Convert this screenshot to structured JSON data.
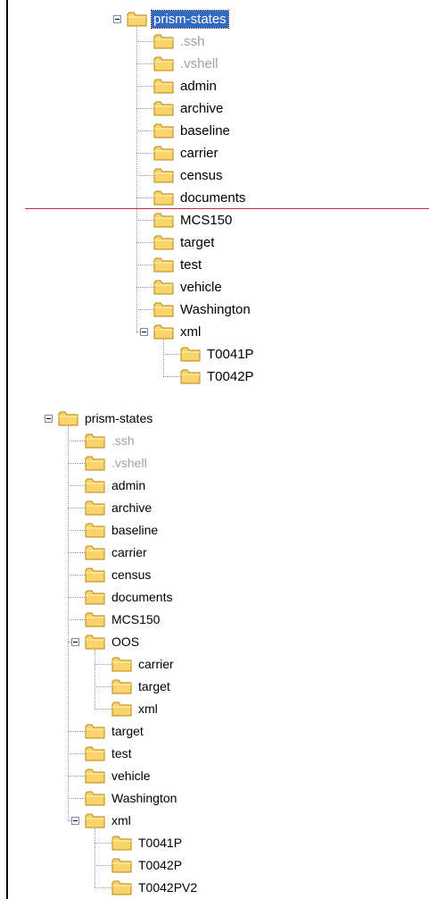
{
  "colors": {
    "selection": "#316ac5",
    "separator": "#d03030",
    "folder_fill": "#f9d46c",
    "folder_stroke": "#b8860b",
    "hidden_text": "#a0a0a0"
  },
  "icons": {
    "folder": "folder-icon",
    "expander": "minus-box-icon"
  },
  "trees": [
    {
      "items": [
        {
          "label": "prism-states",
          "depth": 0,
          "expanded": true,
          "selected": true
        },
        {
          "label": ".ssh",
          "depth": 1,
          "dim": true
        },
        {
          "label": ".vshell",
          "depth": 1,
          "dim": true
        },
        {
          "label": "admin",
          "depth": 1
        },
        {
          "label": "archive",
          "depth": 1
        },
        {
          "label": "baseline",
          "depth": 1
        },
        {
          "label": "carrier",
          "depth": 1
        },
        {
          "label": "census",
          "depth": 1
        },
        {
          "label": "documents",
          "depth": 1
        },
        {
          "label": "MCS150",
          "depth": 1
        },
        {
          "label": "target",
          "depth": 1
        },
        {
          "label": "test",
          "depth": 1
        },
        {
          "label": "vehicle",
          "depth": 1
        },
        {
          "label": "Washington",
          "depth": 1
        },
        {
          "label": "xml",
          "depth": 1,
          "expanded": true
        },
        {
          "label": "T0041P",
          "depth": 2
        },
        {
          "label": "T0042P",
          "depth": 2
        }
      ]
    },
    {
      "items": [
        {
          "label": "prism-states",
          "depth": 0,
          "expanded": true
        },
        {
          "label": ".ssh",
          "depth": 1,
          "dim": true
        },
        {
          "label": ".vshell",
          "depth": 1,
          "dim": true
        },
        {
          "label": "admin",
          "depth": 1
        },
        {
          "label": "archive",
          "depth": 1
        },
        {
          "label": "baseline",
          "depth": 1
        },
        {
          "label": "carrier",
          "depth": 1
        },
        {
          "label": "census",
          "depth": 1
        },
        {
          "label": "documents",
          "depth": 1
        },
        {
          "label": "MCS150",
          "depth": 1
        },
        {
          "label": "OOS",
          "depth": 1,
          "expanded": true
        },
        {
          "label": "carrier",
          "depth": 2
        },
        {
          "label": "target",
          "depth": 2
        },
        {
          "label": "xml",
          "depth": 2
        },
        {
          "label": "target",
          "depth": 1
        },
        {
          "label": "test",
          "depth": 1
        },
        {
          "label": "vehicle",
          "depth": 1
        },
        {
          "label": "Washington",
          "depth": 1
        },
        {
          "label": "xml",
          "depth": 1,
          "expanded": true
        },
        {
          "label": "T0041P",
          "depth": 2
        },
        {
          "label": "T0042P",
          "depth": 2
        },
        {
          "label": "T0042PV2",
          "depth": 2
        }
      ]
    }
  ]
}
